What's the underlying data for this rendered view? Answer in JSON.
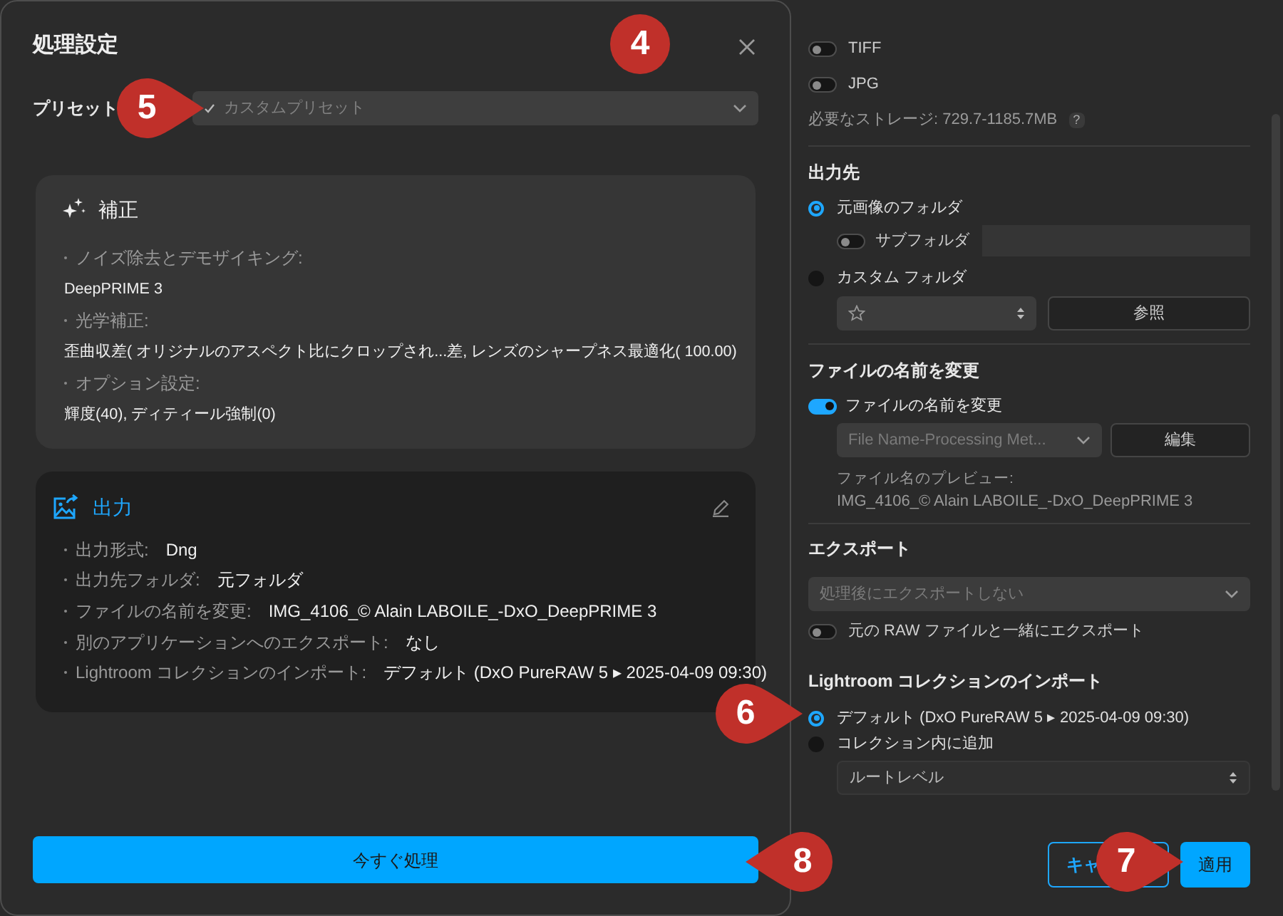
{
  "dialog": {
    "title": "処理設定",
    "preset": {
      "label": "プリセット",
      "value": "カスタムプリセット"
    },
    "corrections": {
      "title": "補正",
      "items": [
        {
          "label": "ノイズ除去とデモザイキング:",
          "value": "DeepPRIME 3"
        },
        {
          "label": "光学補正:",
          "value": "歪曲収差( オリジナルのアスペクト比にクロップされ...差, レンズのシャープネス最適化( 100.00)"
        },
        {
          "label": "オプション設定:",
          "value": "輝度(40), ディティール強制(0)"
        }
      ]
    },
    "output": {
      "title": "出力",
      "items": [
        {
          "label": "出力形式:",
          "value": "Dng"
        },
        {
          "label": "出力先フォルダ:",
          "value": "元フォルダ"
        },
        {
          "label": "ファイルの名前を変更:",
          "value": "IMG_4106_© Alain LABOILE_-DxO_DeepPRIME 3"
        },
        {
          "label": "別のアプリケーションへのエクスポート:",
          "value": "なし"
        },
        {
          "label": "Lightroom コレクションのインポート:",
          "value": "デフォルト (DxO PureRAW 5 ▸ 2025-04-09 09:30)"
        }
      ]
    },
    "process_button": "今すぐ処理"
  },
  "settings": {
    "formats": [
      {
        "label": "TIFF",
        "on": false
      },
      {
        "label": "JPG",
        "on": false
      }
    ],
    "storage": "必要なストレージ: 729.7-1185.7MB",
    "storage_help": "?",
    "destination": {
      "heading": "出力先",
      "options": [
        {
          "label": "元画像のフォルダ",
          "selected": true
        },
        {
          "label": "カスタム フォルダ",
          "selected": false
        }
      ],
      "subfolder": {
        "label": "サブフォルダ",
        "on": false
      },
      "browse_button": "参照"
    },
    "rename": {
      "heading": "ファイルの名前を変更",
      "toggle": {
        "label": "ファイルの名前を変更",
        "on": true
      },
      "template": "File Name-Processing Met...",
      "edit_button": "編集",
      "preview_label": "ファイル名のプレビュー:",
      "preview": "IMG_4106_© Alain LABOILE_-DxO_DeepPRIME 3"
    },
    "export": {
      "heading": "エクスポート",
      "target": "処理後にエクスポートしない",
      "with_raw": {
        "label": "元の RAW ファイルと一緒にエクスポート",
        "on": false
      }
    },
    "lightroom": {
      "heading": "Lightroom コレクションのインポート",
      "options": [
        {
          "label": "デフォルト (DxO PureRAW 5 ▸ 2025-04-09 09:30)",
          "selected": true
        },
        {
          "label": "コレクション内に追加",
          "selected": false
        }
      ],
      "level": "ルートレベル"
    },
    "buttons": [
      {
        "label": "キャ",
        "kind": "secondary"
      },
      {
        "label": "適用",
        "kind": "primary"
      }
    ]
  },
  "callouts": [
    {
      "label": "4",
      "kind": "circle"
    },
    {
      "label": "5",
      "kind": "pin-right"
    },
    {
      "label": "6",
      "kind": "pin-right"
    },
    {
      "label": "7",
      "kind": "pin-right"
    },
    {
      "label": "8",
      "kind": "pin-left"
    }
  ]
}
